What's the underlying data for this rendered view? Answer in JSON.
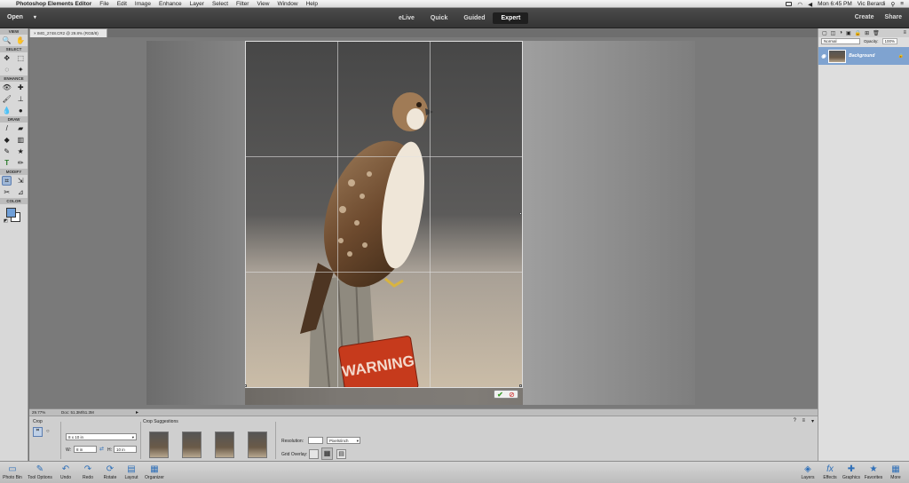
{
  "menubar": {
    "app": "Photoshop Elements Editor",
    "items": [
      "File",
      "Edit",
      "Image",
      "Enhance",
      "Layer",
      "Select",
      "Filter",
      "View",
      "Window",
      "Help"
    ],
    "clock": "Mon 6:45 PM",
    "user": "Vic Berardi"
  },
  "topbar": {
    "open_label": "Open",
    "modes": [
      "eLive",
      "Quick",
      "Guided",
      "Expert"
    ],
    "active_mode": "Expert",
    "create_label": "Create",
    "share_label": "Share"
  },
  "toolbox": {
    "sections": [
      "VIEW",
      "SELECT",
      "ENHANCE",
      "DRAW",
      "MODIFY",
      "COLOR"
    ]
  },
  "document": {
    "tab_title": "IMG_2748.CR2 @ 29.8% (RGB/8)",
    "zoom": "29.77%",
    "doc_size": "Doc: 51.3M/51.3M"
  },
  "photo_text": "WARNING",
  "options": {
    "tool_name": "Crop",
    "suggestions_label": "Crop Suggestions",
    "preset": "8 x 10 in",
    "width_label": "W:",
    "width_value": "8 in",
    "height_label": "H:",
    "height_value": "10 in",
    "resolution_label": "Resolution:",
    "resolution_unit": "Pixels/inch",
    "grid_overlay_label": "Grid Overlay:"
  },
  "layers": {
    "blend_mode": "Normal",
    "opacity_label": "Opacity:",
    "opacity_value": "100%",
    "layer_name": "Background"
  },
  "dock_left": [
    "Photo Bin",
    "Tool Options",
    "Undo",
    "Redo",
    "Rotate",
    "Layout",
    "Organizer"
  ],
  "dock_right": [
    "Layers",
    "Effects",
    "Graphics",
    "Favorites",
    "More"
  ],
  "colors": {
    "accent_blue": "#7fa3d0",
    "warning_sign": "#c63a1c"
  }
}
